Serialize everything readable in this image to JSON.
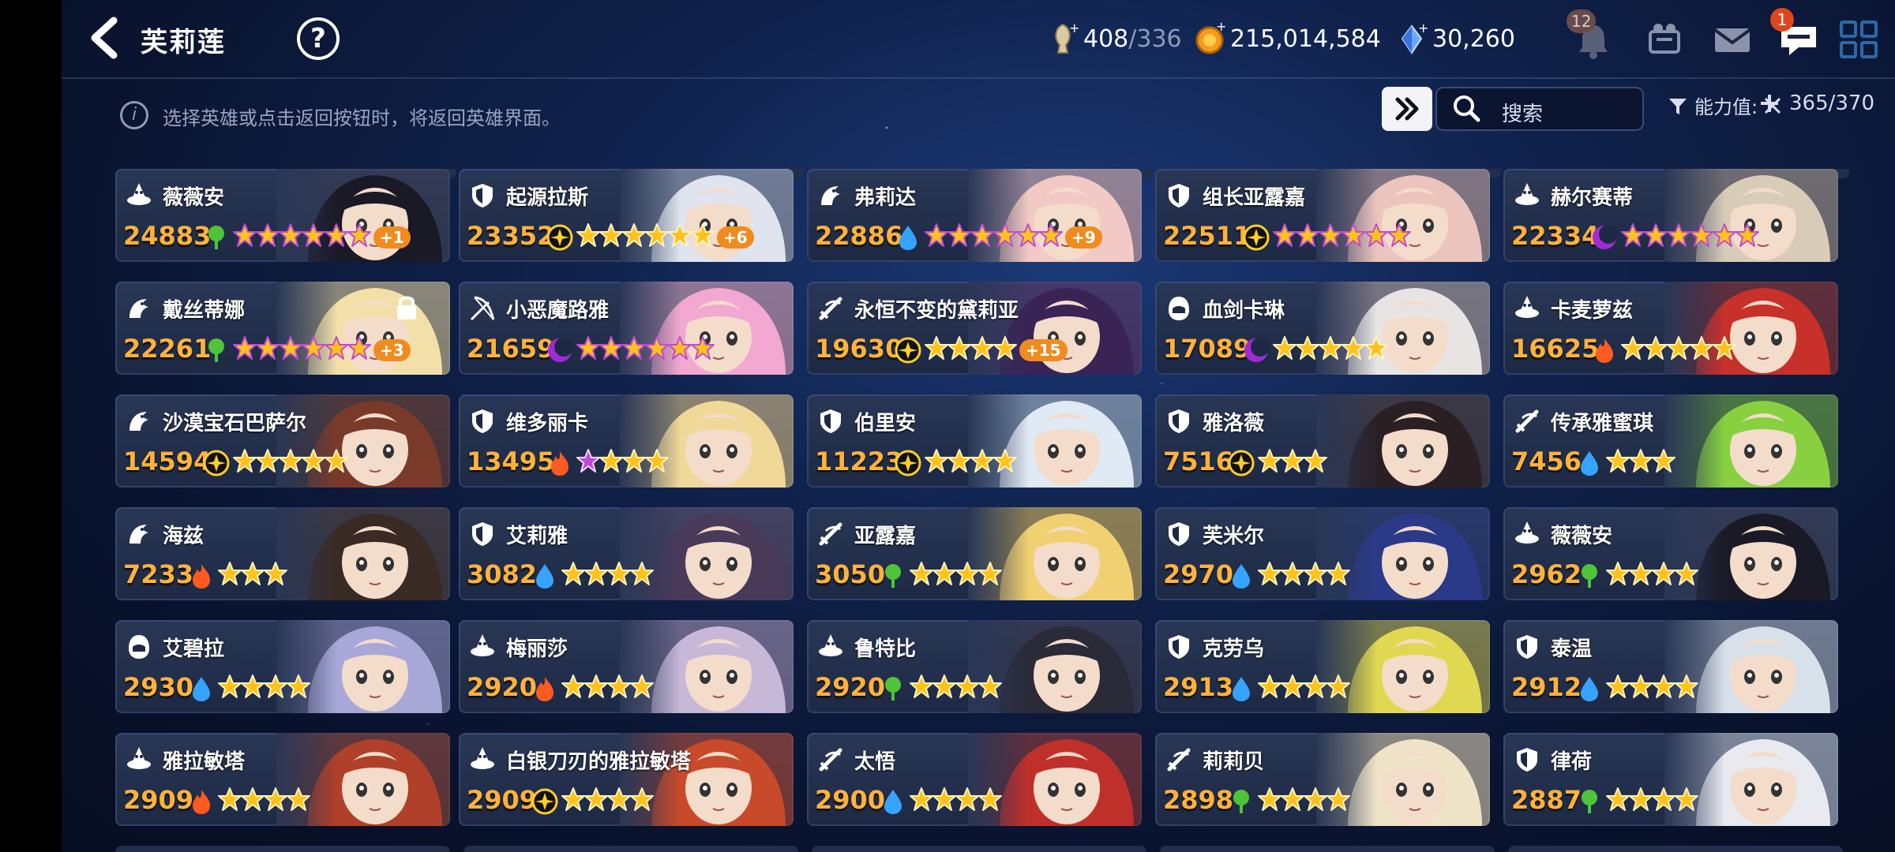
{
  "header": {
    "title": "芙莉莲",
    "help_label": "?",
    "stamina": {
      "current": "408",
      "max": "/336"
    },
    "gold": "215,014,584",
    "crystal": "30,260",
    "notification_badge": "12",
    "chat_badge": "1"
  },
  "info_bar": {
    "hint": "选择英雄或点击返回按钮时，将返回英雄界面。",
    "search_label": "搜索",
    "filter_label": "能力值:",
    "count": "365/370"
  },
  "colors": {
    "power": "#ffb23a",
    "earth": "#4fc43a",
    "water": "#36a3ff",
    "fire": "#ff5a1f",
    "light": "#ffcf2a",
    "dark": "#a02ad8",
    "star_gold": "#ffc21a",
    "star_purple": "#c04ad8",
    "plus_badge": "#f08b1e"
  },
  "heroes": [
    {
      "name": "薇薇安",
      "power": "24883",
      "class": "mage-icon",
      "element": "earth",
      "stars": 6,
      "star_style": "purple",
      "plus": "+1",
      "hue": "#3a3e55",
      "hair": "#1a1a26"
    },
    {
      "name": "起源拉斯",
      "power": "23352",
      "class": "shield-icon",
      "element": "light",
      "stars": 6,
      "star_style": "gold",
      "plus": "+6",
      "hue": "#aab4c8",
      "hair": "#dfe4ee"
    },
    {
      "name": "弗莉达",
      "power": "22886",
      "class": "dragon-icon",
      "element": "water",
      "stars": 6,
      "star_style": "purple",
      "plus": "+9",
      "hue": "#e8c0c8",
      "hair": "#f2c9c4"
    },
    {
      "name": "组长亚露嘉",
      "power": "22511",
      "class": "shield-icon",
      "element": "light",
      "stars": 6,
      "star_style": "purple",
      "plus": "",
      "hue": "#c8a8a8",
      "hair": "#ecc4be"
    },
    {
      "name": "赫尔赛蒂",
      "power": "22334",
      "class": "mage-icon",
      "element": "dark",
      "stars": 6,
      "star_style": "purple",
      "plus": "",
      "hue": "#a89888",
      "hair": "#d8ccb8"
    },
    {
      "name": "戴丝蒂娜",
      "power": "22261",
      "class": "dragon-icon",
      "element": "earth",
      "stars": 6,
      "star_style": "purple",
      "plus": "+3",
      "hue": "#d8c898",
      "hair": "#f2e0a8"
    },
    {
      "name": "小恶魔路雅",
      "power": "21659",
      "class": "bow-icon",
      "element": "dark",
      "stars": 6,
      "star_style": "purple",
      "plus": "",
      "hue": "#e0a8c8",
      "hair": "#f2a8d0"
    },
    {
      "name": "永恒不变的黛莉亚",
      "power": "19630",
      "class": "sword-icon",
      "element": "light",
      "stars": 4,
      "star_style": "gold",
      "plus": "+15",
      "hue": "#5a3a78",
      "hair": "#3a2456"
    },
    {
      "name": "血剑卡琳",
      "power": "17089",
      "class": "assassin-icon",
      "element": "dark",
      "stars": 5,
      "star_style": "gold",
      "plus": "",
      "hue": "#b8a8a8",
      "hair": "#e8e4e4"
    },
    {
      "name": "卡麦萝兹",
      "power": "16625",
      "class": "mage-icon",
      "element": "fire",
      "stars": 5,
      "star_style": "gold",
      "plus": "",
      "hue": "#8a2a2a",
      "hair": "#c8302a"
    },
    {
      "name": "沙漠宝石巴萨尔",
      "power": "14594",
      "class": "dragon-icon",
      "element": "light",
      "stars": 5,
      "star_style": "gold",
      "plus": "",
      "hue": "#6a3a2a",
      "hair": "#7a3a2a"
    },
    {
      "name": "维多丽卡",
      "power": "13495",
      "class": "shield-icon",
      "element": "fire",
      "stars": 4,
      "star_style": "mixed",
      "plus": "",
      "hue": "#d8c088",
      "hair": "#f0d898"
    },
    {
      "name": "伯里安",
      "power": "11223",
      "class": "shield-icon",
      "element": "light",
      "stars": 4,
      "star_style": "gold",
      "plus": "",
      "hue": "#a8c0d8",
      "hair": "#e0eaf4"
    },
    {
      "name": "雅洛薇",
      "power": "7516",
      "class": "shield-icon",
      "element": "light",
      "stars": 3,
      "star_style": "gold",
      "plus": "",
      "hue": "#4a3a3a",
      "hair": "#2a2024"
    },
    {
      "name": "传承雅蜜琪",
      "power": "7456",
      "class": "sword-icon",
      "element": "water",
      "stars": 3,
      "star_style": "gold",
      "plus": "",
      "hue": "#68a838",
      "hair": "#88d040"
    },
    {
      "name": "海兹",
      "power": "7233",
      "class": "dragon-icon",
      "element": "fire",
      "stars": 3,
      "star_style": "gold",
      "plus": "",
      "hue": "#4a3a34",
      "hair": "#3a2a24"
    },
    {
      "name": "艾莉雅",
      "power": "3082",
      "class": "shield-icon",
      "element": "water",
      "stars": 4,
      "star_style": "gold",
      "plus": "",
      "hue": "#5a4a6a",
      "hair": "#4a3a5a"
    },
    {
      "name": "亚露嘉",
      "power": "3050",
      "class": "sword-icon",
      "element": "earth",
      "stars": 4,
      "star_style": "gold",
      "plus": "",
      "hue": "#d8b858",
      "hair": "#f0d070"
    },
    {
      "name": "芙米尔",
      "power": "2970",
      "class": "shield-icon",
      "element": "water",
      "stars": 4,
      "star_style": "gold",
      "plus": "",
      "hue": "#2a3a78",
      "hair": "#2a3a88"
    },
    {
      "name": "薇薇安",
      "power": "2962",
      "class": "mage-icon",
      "element": "earth",
      "stars": 4,
      "star_style": "gold",
      "plus": "",
      "hue": "#3a3e55",
      "hair": "#1a1a26"
    },
    {
      "name": "艾碧拉",
      "power": "2930",
      "class": "assassin-icon",
      "element": "water",
      "stars": 4,
      "star_style": "gold",
      "plus": "",
      "hue": "#8a88b8",
      "hair": "#a8a8d8"
    },
    {
      "name": "梅丽莎",
      "power": "2920",
      "class": "mage-icon",
      "element": "fire",
      "stars": 4,
      "star_style": "gold",
      "plus": "",
      "hue": "#9a8ab0",
      "hair": "#c8b8d8"
    },
    {
      "name": "鲁特比",
      "power": "2920",
      "class": "mage-icon",
      "element": "earth",
      "stars": 4,
      "star_style": "gold",
      "plus": "",
      "hue": "#3a3a4a",
      "hair": "#2a2a38"
    },
    {
      "name": "克劳乌",
      "power": "2913",
      "class": "shield-icon",
      "element": "water",
      "stars": 4,
      "star_style": "gold",
      "plus": "",
      "hue": "#b8b048",
      "hair": "#e0d850"
    },
    {
      "name": "泰温",
      "power": "2912",
      "class": "shield-icon",
      "element": "water",
      "stars": 4,
      "star_style": "gold",
      "plus": "",
      "hue": "#a8b0c0",
      "hair": "#d8e0ea"
    },
    {
      "name": "雅拉敏塔",
      "power": "2909",
      "class": "mage-icon",
      "element": "fire",
      "stars": 4,
      "star_style": "gold",
      "plus": "",
      "hue": "#8a3a2a",
      "hair": "#b0402a"
    },
    {
      "name": "白银刀刃的雅拉敏塔",
      "power": "2909",
      "class": "mage-icon",
      "element": "light",
      "stars": 4,
      "star_style": "gold",
      "plus": "",
      "hue": "#b0402a",
      "hair": "#c84a2a"
    },
    {
      "name": "太悟",
      "power": "2900",
      "class": "sword-icon",
      "element": "water",
      "stars": 4,
      "star_style": "gold",
      "plus": "",
      "hue": "#8a2a2a",
      "hair": "#c0302a"
    },
    {
      "name": "莉莉贝",
      "power": "2898",
      "class": "sword-icon",
      "element": "earth",
      "stars": 4,
      "star_style": "gold",
      "plus": "",
      "hue": "#d8c8a8",
      "hair": "#f0e4c8"
    },
    {
      "name": "律荷",
      "power": "2887",
      "class": "shield-icon",
      "element": "earth",
      "stars": 4,
      "star_style": "gold",
      "plus": "",
      "hue": "#c0c4d0",
      "hair": "#e8eaf0"
    }
  ]
}
